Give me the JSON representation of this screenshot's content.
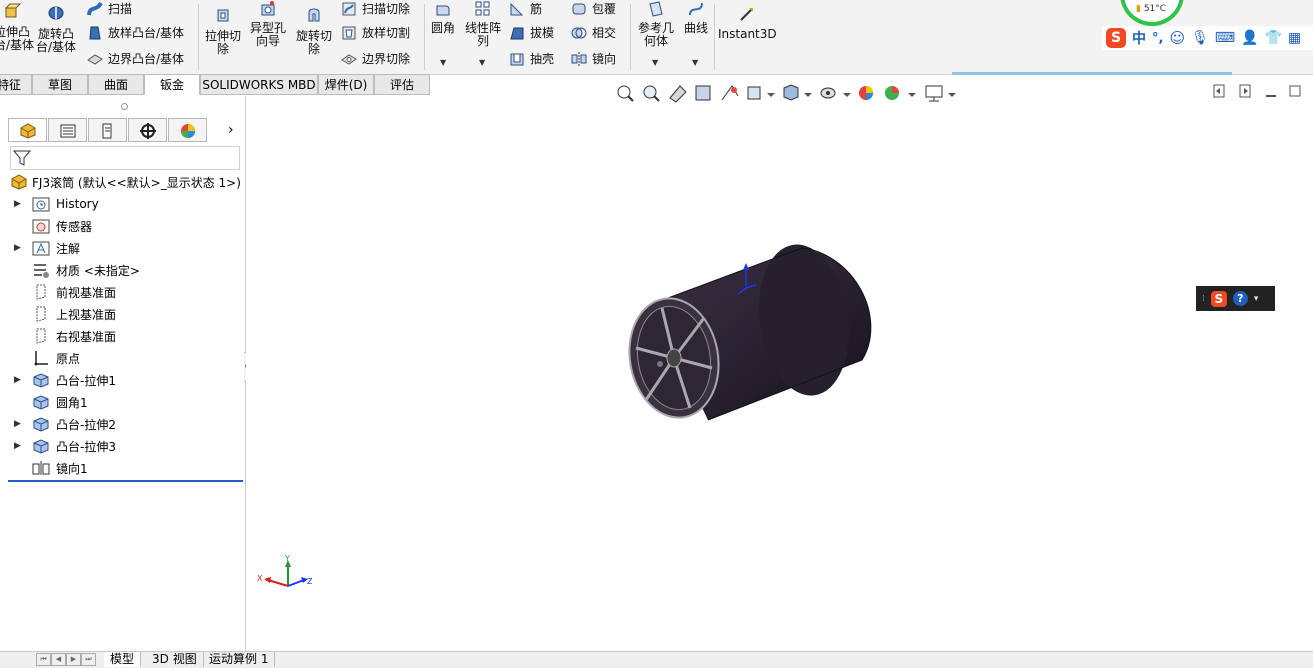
{
  "ribbon": {
    "extrude_boss": "拉伸凸\n台/基体",
    "revolve_boss": "旋转凸\n台/基体",
    "sweep": "扫描",
    "loft_boss": "放样凸台/基体",
    "boundary_boss": "边界凸台/基体",
    "extrude_cut": "拉伸切\n除",
    "hole_wizard": "异型孔\n向导",
    "revolve_cut": "旋转切\n除",
    "sweep_cut": "扫描切除",
    "loft_cut": "放样切割",
    "boundary_cut": "边界切除",
    "fillet": "圆角",
    "linear_pattern": "线性阵\n列",
    "rib": "筋",
    "draft": "拔模",
    "shell": "抽壳",
    "wrap": "包覆",
    "intersect": "相交",
    "mirror": "镜向",
    "ref_geometry": "参考几\n何体",
    "curves": "曲线",
    "instant3d": "Instant3D"
  },
  "tabs": [
    {
      "label": "特征",
      "active": false
    },
    {
      "label": "草图",
      "active": false
    },
    {
      "label": "曲面",
      "active": false
    },
    {
      "label": "钣金",
      "active": true
    },
    {
      "label": "SOLIDWORKS MBD",
      "active": false
    },
    {
      "label": "焊件(D)",
      "active": false
    },
    {
      "label": "评估",
      "active": false
    }
  ],
  "tree": {
    "root": "FJ3滚筒  (默认<<默认>_显示状态 1>)",
    "items": [
      {
        "label": "History",
        "expandable": true
      },
      {
        "label": "传感器",
        "expandable": false
      },
      {
        "label": "注解",
        "expandable": true
      },
      {
        "label": "材质 <未指定>",
        "expandable": false
      },
      {
        "label": "前视基准面",
        "expandable": false
      },
      {
        "label": "上视基准面",
        "expandable": false
      },
      {
        "label": "右视基准面",
        "expandable": false
      },
      {
        "label": "原点",
        "expandable": false
      },
      {
        "label": "凸台-拉伸1",
        "expandable": true
      },
      {
        "label": "圆角1",
        "expandable": false
      },
      {
        "label": "凸台-拉伸2",
        "expandable": true
      },
      {
        "label": "凸台-拉伸3",
        "expandable": true
      },
      {
        "label": "镜向1",
        "expandable": false
      }
    ]
  },
  "triad": {
    "x": "X",
    "y": "Y",
    "z": "Z"
  },
  "status_tabs": [
    {
      "label": "模型",
      "active": true
    },
    {
      "label": "3D 视图",
      "active": false
    },
    {
      "label": "运动算例 1",
      "active": false
    }
  ],
  "ime": {
    "mode": "中",
    "punct": "°,",
    "temp": "51°C"
  },
  "colors": {
    "accent": "#1f5fbf",
    "part": "#2a2232"
  }
}
